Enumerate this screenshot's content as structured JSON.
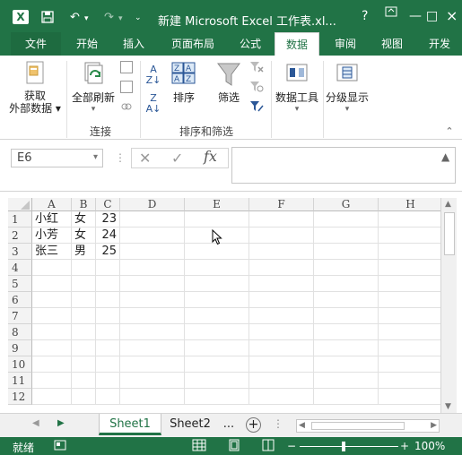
{
  "titlebar": {
    "app_icon": "excel-logo-icon",
    "title": "新建 Microsoft Excel 工作表.xl...",
    "help": "?",
    "minimize": "—",
    "restore": "□",
    "close": "×",
    "undo": "↶",
    "redo": "↷",
    "save": "save-icon"
  },
  "tabs": [
    "文件",
    "开始",
    "插入",
    "页面布局",
    "公式",
    "数据",
    "审阅",
    "视图",
    "开发"
  ],
  "active_tab": "数据",
  "ribbon": {
    "get_external": "获取\n外部数据",
    "get_external_l1": "获取",
    "get_external_l2": "外部数据",
    "refresh_all": "全部刷新",
    "sort": "排序",
    "filter": "筛选",
    "data_tools": "数据工具",
    "outline": "分级显示",
    "group_connections": "连接",
    "group_sort_filter": "排序和筛选"
  },
  "formula": {
    "name_box": "E6",
    "fx": "fx",
    "value": ""
  },
  "grid": {
    "columns": [
      "A",
      "B",
      "C",
      "D",
      "E",
      "F",
      "G",
      "H"
    ],
    "rows": [
      "1",
      "2",
      "3",
      "4",
      "5",
      "6",
      "7",
      "8",
      "9",
      "10",
      "11",
      "12"
    ],
    "cells": [
      [
        "小红",
        "女",
        "23"
      ],
      [
        "小芳",
        "女",
        "24"
      ],
      [
        "张三",
        "男",
        "25"
      ]
    ]
  },
  "sheets": [
    "Sheet1",
    "Sheet2"
  ],
  "active_sheet": "Sheet1",
  "sheet_more": "...",
  "status": {
    "ready": "就绪",
    "zoom": "100%",
    "zoom_minus": "−",
    "zoom_plus": "+"
  },
  "colors": {
    "excel_green": "#217346",
    "grid_line": "#e1e1e1"
  }
}
